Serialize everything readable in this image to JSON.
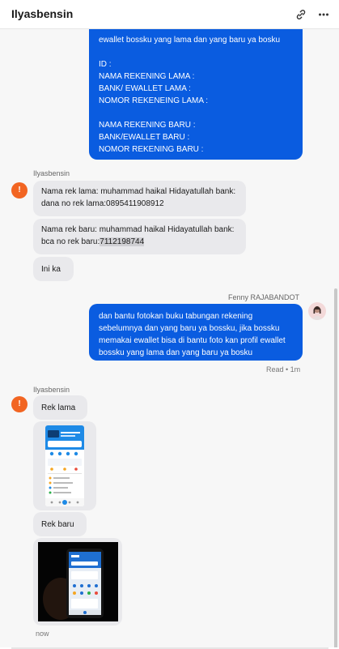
{
  "header": {
    "title": "Ilyasbensin"
  },
  "messages": {
    "out1": {
      "lines": [
        "ewallet bossku yang lama dan yang baru ya bosku",
        "",
        "ID :",
        "NAMA REKENING LAMA :",
        "BANK/ EWALLET LAMA :",
        "NOMOR REKENEING LAMA :",
        "",
        "NAMA REKENING BARU :",
        "BANK/EWALLET BARU :",
        "NOMOR REKENING BARU :"
      ]
    },
    "in_group1": {
      "sender": "Ilyasbensin",
      "avatar_letter": "!",
      "msg1_line1": "Nama rek lama: muhammad haikal Hidayatullah bank:",
      "msg1_line2": "dana no rek lama:0895411908912",
      "msg2_line1": "Nama rek baru: muhammad haikal Hidayatullah bank:",
      "msg2_line2_prefix": "bca no rek baru:",
      "msg2_line2_highlight": "7112198744",
      "msg3": "Ini ka"
    },
    "out2": {
      "sender": "Fenny RAJABANDOT",
      "lines": [
        "dan bantu fotokan buku tabungan rekening",
        "sebelumnya dan yang baru ya bossku, jika bossku",
        "memakai ewallet bisa di bantu foto kan profil ewallet",
        "bossku yang lama dan yang baru ya bosku"
      ],
      "status": "Read • 1m"
    },
    "in_group2": {
      "sender": "Ilyasbensin",
      "avatar_letter": "!",
      "msg1": "Rek lama",
      "msg2": "Rek baru",
      "time": "now"
    }
  },
  "colors": {
    "outgoing_bubble": "#0a5ce0",
    "incoming_bubble": "#e9e9ec",
    "avatar": "#f26522"
  },
  "icons": {
    "link": "link-icon",
    "more": "more-icon"
  }
}
